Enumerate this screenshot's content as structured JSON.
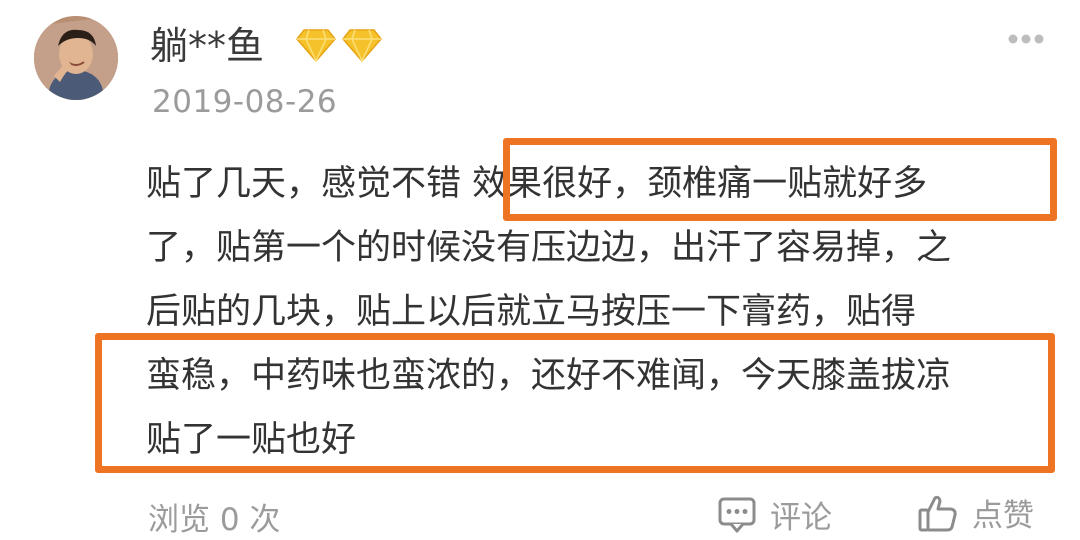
{
  "post": {
    "username": "躺**鱼",
    "date": "2019-08-26",
    "badges": [
      "diamond-icon",
      "diamond-icon"
    ],
    "badge_color": "#f6c22b",
    "content_lines": [
      "贴了几天，感觉不错  效果很好，颈椎痛一贴就好多",
      "了，贴第一个的时候没有压边边，出汗了容易掉，之",
      "后贴的几块，贴上以后就立马按压一下膏药，贴得",
      "蛮稳，中药味也蛮浓的，还好不难闻，今天膝盖拔凉",
      "贴了一贴也好"
    ],
    "highlight_color": "#ee7424"
  },
  "footer": {
    "views_label": "浏览 0 次",
    "comment_label": "评论",
    "like_label": "点赞"
  }
}
